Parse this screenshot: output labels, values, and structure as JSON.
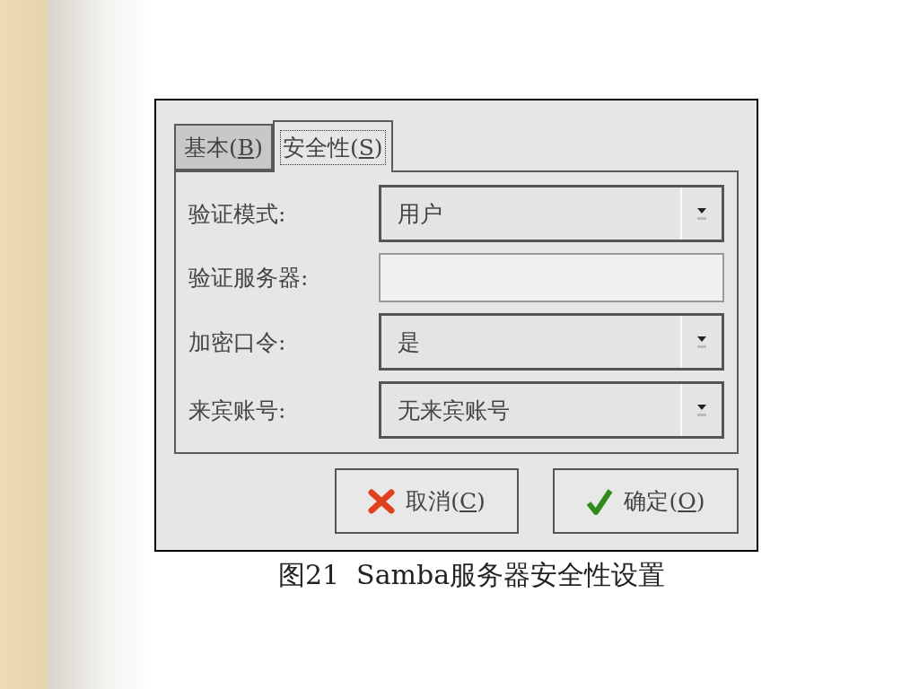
{
  "tabs": [
    {
      "label": "基本(",
      "mnemonic": "B",
      "suffix": ")",
      "selected": false
    },
    {
      "label": "安全性(",
      "mnemonic": "S",
      "suffix": ")",
      "selected": true
    }
  ],
  "fields": [
    {
      "kind": "dropdown",
      "label": "验证模式:",
      "value": "用户"
    },
    {
      "kind": "text",
      "label": "验证服务器:"
    },
    {
      "kind": "dropdown",
      "label": "加密口令:",
      "value": "是"
    },
    {
      "kind": "dropdown",
      "label": "来宾账号:",
      "value": "无来宾账号"
    }
  ],
  "buttons": [
    {
      "kind": "cancel",
      "label": "取消(",
      "mnemonic": "C",
      "suffix": ")"
    },
    {
      "kind": "ok",
      "label": "确定(",
      "mnemonic": "O",
      "suffix": ")"
    }
  ],
  "caption": "图21  Samba服务器安全性设置"
}
